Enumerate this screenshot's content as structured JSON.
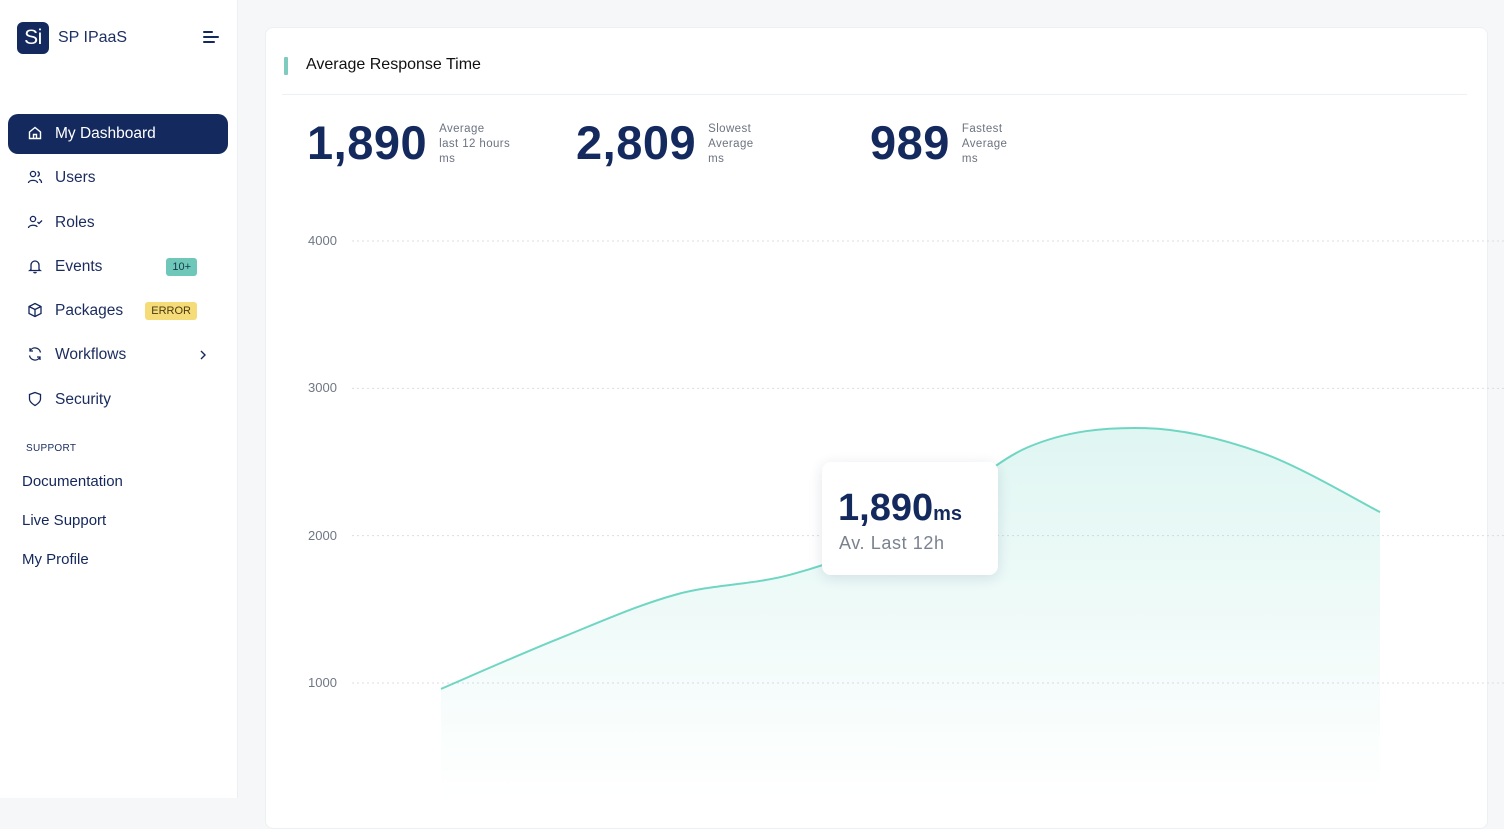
{
  "app": {
    "logo_text": "Si",
    "name": "SP IPaaS"
  },
  "sidebar": {
    "items": [
      {
        "label": "My Dashboard",
        "icon": "home-icon",
        "active": true
      },
      {
        "label": "Users",
        "icon": "users-icon"
      },
      {
        "label": "Roles",
        "icon": "user-check-icon"
      },
      {
        "label": "Events",
        "icon": "bell-icon",
        "badge": "10+"
      },
      {
        "label": "Packages",
        "icon": "box-icon",
        "badge": "ERROR"
      },
      {
        "label": "Workflows",
        "icon": "refresh-icon",
        "has_submenu": true
      },
      {
        "label": "Security",
        "icon": "shield-icon"
      }
    ],
    "support_title": "SUPPORT",
    "support_links": [
      "Documentation",
      "Live Support",
      "My Profile"
    ]
  },
  "card": {
    "title": "Average Response Time",
    "stats": [
      {
        "value": "1,890",
        "desc": [
          "Average",
          "last 12 hours",
          "ms"
        ]
      },
      {
        "value": "2,809",
        "desc": [
          "Slowest",
          "Average",
          "ms"
        ]
      },
      {
        "value": "989",
        "desc": [
          "Fastest",
          "Average",
          "ms"
        ]
      }
    ],
    "tooltip": {
      "value": "1,890",
      "unit": "ms",
      "label": "Av. Last 12h"
    }
  },
  "colors": {
    "primary": "#142a5e",
    "accent": "#6fd6c4",
    "badge_teal": "#6fc7b9",
    "badge_yellow": "#f5dc78"
  },
  "chart_data": {
    "type": "area",
    "y_ticks": [
      4000,
      3000,
      2000,
      1000
    ],
    "ylim": [
      500,
      4000
    ],
    "x": [
      0,
      1,
      2,
      3,
      4,
      5,
      6,
      7,
      8
    ],
    "values": [
      960,
      1300,
      1600,
      1740,
      2050,
      2600,
      2730,
      2560,
      2160
    ],
    "grid": true
  }
}
